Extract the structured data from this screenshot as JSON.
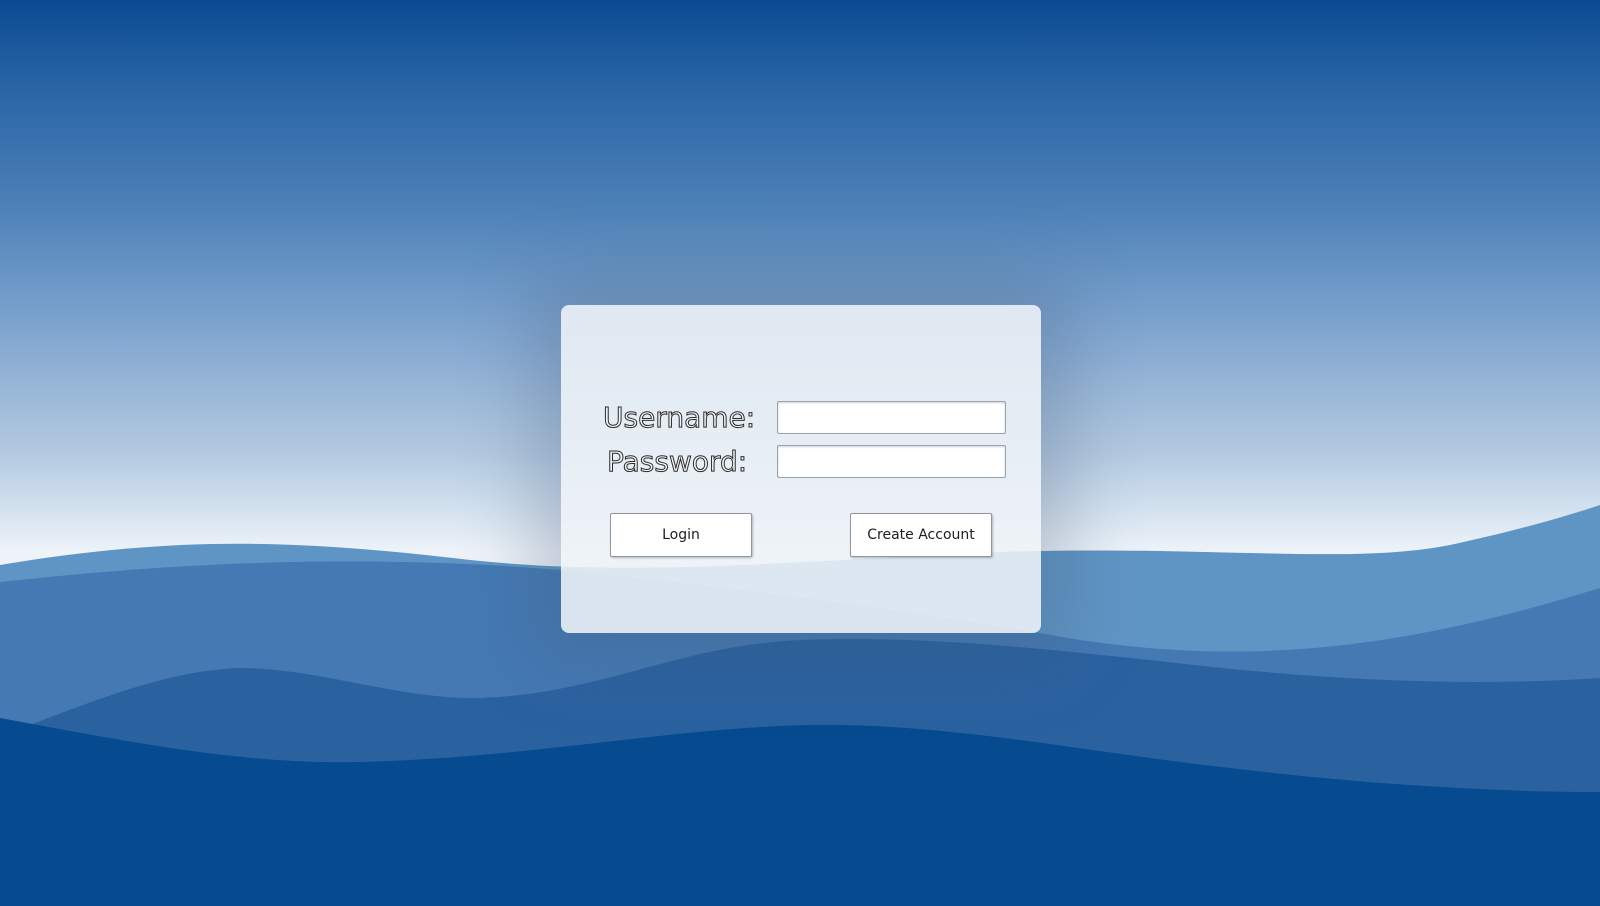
{
  "background": {
    "top_color": "#0b4a93",
    "horizon_color": "#eef3f9",
    "wave_colors": [
      "#5f95c5",
      "#4479b3",
      "#2a62a0",
      "#064a8f"
    ]
  },
  "login_form": {
    "username_label": "Username:",
    "username_value": "",
    "password_label": "Password:",
    "password_value": "",
    "login_button": "Login",
    "create_account_button": "Create Account"
  }
}
